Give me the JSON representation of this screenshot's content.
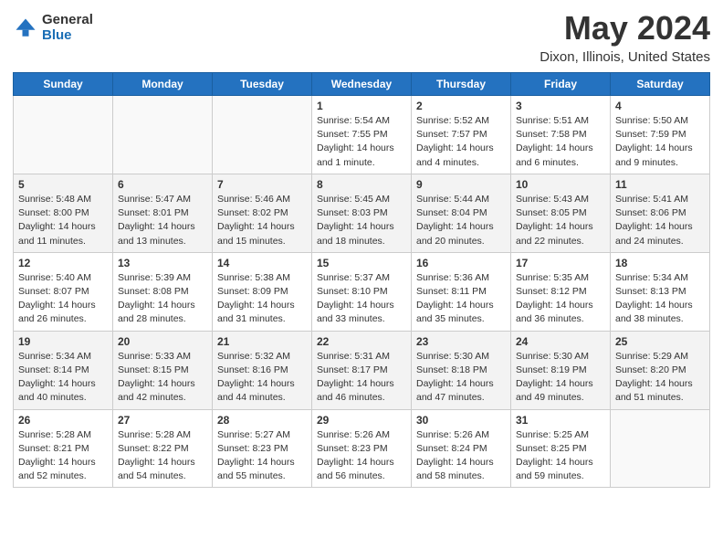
{
  "logo": {
    "general": "General",
    "blue": "Blue"
  },
  "title": "May 2024",
  "subtitle": "Dixon, Illinois, United States",
  "days_of_week": [
    "Sunday",
    "Monday",
    "Tuesday",
    "Wednesday",
    "Thursday",
    "Friday",
    "Saturday"
  ],
  "weeks": [
    [
      {
        "day": "",
        "info": ""
      },
      {
        "day": "",
        "info": ""
      },
      {
        "day": "",
        "info": ""
      },
      {
        "day": "1",
        "info": "Sunrise: 5:54 AM\nSunset: 7:55 PM\nDaylight: 14 hours\nand 1 minute."
      },
      {
        "day": "2",
        "info": "Sunrise: 5:52 AM\nSunset: 7:57 PM\nDaylight: 14 hours\nand 4 minutes."
      },
      {
        "day": "3",
        "info": "Sunrise: 5:51 AM\nSunset: 7:58 PM\nDaylight: 14 hours\nand 6 minutes."
      },
      {
        "day": "4",
        "info": "Sunrise: 5:50 AM\nSunset: 7:59 PM\nDaylight: 14 hours\nand 9 minutes."
      }
    ],
    [
      {
        "day": "5",
        "info": "Sunrise: 5:48 AM\nSunset: 8:00 PM\nDaylight: 14 hours\nand 11 minutes."
      },
      {
        "day": "6",
        "info": "Sunrise: 5:47 AM\nSunset: 8:01 PM\nDaylight: 14 hours\nand 13 minutes."
      },
      {
        "day": "7",
        "info": "Sunrise: 5:46 AM\nSunset: 8:02 PM\nDaylight: 14 hours\nand 15 minutes."
      },
      {
        "day": "8",
        "info": "Sunrise: 5:45 AM\nSunset: 8:03 PM\nDaylight: 14 hours\nand 18 minutes."
      },
      {
        "day": "9",
        "info": "Sunrise: 5:44 AM\nSunset: 8:04 PM\nDaylight: 14 hours\nand 20 minutes."
      },
      {
        "day": "10",
        "info": "Sunrise: 5:43 AM\nSunset: 8:05 PM\nDaylight: 14 hours\nand 22 minutes."
      },
      {
        "day": "11",
        "info": "Sunrise: 5:41 AM\nSunset: 8:06 PM\nDaylight: 14 hours\nand 24 minutes."
      }
    ],
    [
      {
        "day": "12",
        "info": "Sunrise: 5:40 AM\nSunset: 8:07 PM\nDaylight: 14 hours\nand 26 minutes."
      },
      {
        "day": "13",
        "info": "Sunrise: 5:39 AM\nSunset: 8:08 PM\nDaylight: 14 hours\nand 28 minutes."
      },
      {
        "day": "14",
        "info": "Sunrise: 5:38 AM\nSunset: 8:09 PM\nDaylight: 14 hours\nand 31 minutes."
      },
      {
        "day": "15",
        "info": "Sunrise: 5:37 AM\nSunset: 8:10 PM\nDaylight: 14 hours\nand 33 minutes."
      },
      {
        "day": "16",
        "info": "Sunrise: 5:36 AM\nSunset: 8:11 PM\nDaylight: 14 hours\nand 35 minutes."
      },
      {
        "day": "17",
        "info": "Sunrise: 5:35 AM\nSunset: 8:12 PM\nDaylight: 14 hours\nand 36 minutes."
      },
      {
        "day": "18",
        "info": "Sunrise: 5:34 AM\nSunset: 8:13 PM\nDaylight: 14 hours\nand 38 minutes."
      }
    ],
    [
      {
        "day": "19",
        "info": "Sunrise: 5:34 AM\nSunset: 8:14 PM\nDaylight: 14 hours\nand 40 minutes."
      },
      {
        "day": "20",
        "info": "Sunrise: 5:33 AM\nSunset: 8:15 PM\nDaylight: 14 hours\nand 42 minutes."
      },
      {
        "day": "21",
        "info": "Sunrise: 5:32 AM\nSunset: 8:16 PM\nDaylight: 14 hours\nand 44 minutes."
      },
      {
        "day": "22",
        "info": "Sunrise: 5:31 AM\nSunset: 8:17 PM\nDaylight: 14 hours\nand 46 minutes."
      },
      {
        "day": "23",
        "info": "Sunrise: 5:30 AM\nSunset: 8:18 PM\nDaylight: 14 hours\nand 47 minutes."
      },
      {
        "day": "24",
        "info": "Sunrise: 5:30 AM\nSunset: 8:19 PM\nDaylight: 14 hours\nand 49 minutes."
      },
      {
        "day": "25",
        "info": "Sunrise: 5:29 AM\nSunset: 8:20 PM\nDaylight: 14 hours\nand 51 minutes."
      }
    ],
    [
      {
        "day": "26",
        "info": "Sunrise: 5:28 AM\nSunset: 8:21 PM\nDaylight: 14 hours\nand 52 minutes."
      },
      {
        "day": "27",
        "info": "Sunrise: 5:28 AM\nSunset: 8:22 PM\nDaylight: 14 hours\nand 54 minutes."
      },
      {
        "day": "28",
        "info": "Sunrise: 5:27 AM\nSunset: 8:23 PM\nDaylight: 14 hours\nand 55 minutes."
      },
      {
        "day": "29",
        "info": "Sunrise: 5:26 AM\nSunset: 8:23 PM\nDaylight: 14 hours\nand 56 minutes."
      },
      {
        "day": "30",
        "info": "Sunrise: 5:26 AM\nSunset: 8:24 PM\nDaylight: 14 hours\nand 58 minutes."
      },
      {
        "day": "31",
        "info": "Sunrise: 5:25 AM\nSunset: 8:25 PM\nDaylight: 14 hours\nand 59 minutes."
      },
      {
        "day": "",
        "info": ""
      }
    ]
  ]
}
